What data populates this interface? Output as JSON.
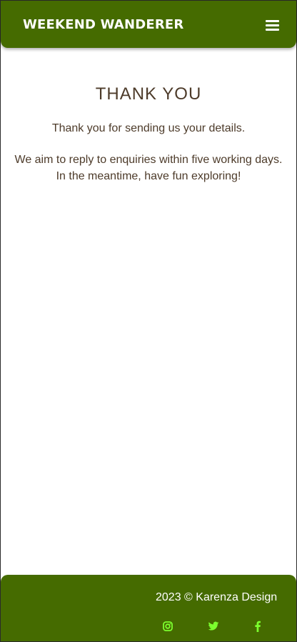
{
  "header": {
    "brand": "WEEKEND WANDERER",
    "menu_icon": "hamburger-menu-icon"
  },
  "main": {
    "title": "THANK YOU",
    "line1": "Thank you for sending us your details.",
    "line2": "We aim to reply to enquiries within five working days.",
    "line3": "In the meantime, have fun exploring!"
  },
  "footer": {
    "copyright": "2023 © Karenza Design",
    "social_icons": [
      "instagram-icon",
      "twitter-icon",
      "facebook-icon"
    ]
  },
  "colors": {
    "brand_green": "#456b00",
    "social_green": "#7cff2e",
    "text_brown": "#4d3b2a"
  }
}
